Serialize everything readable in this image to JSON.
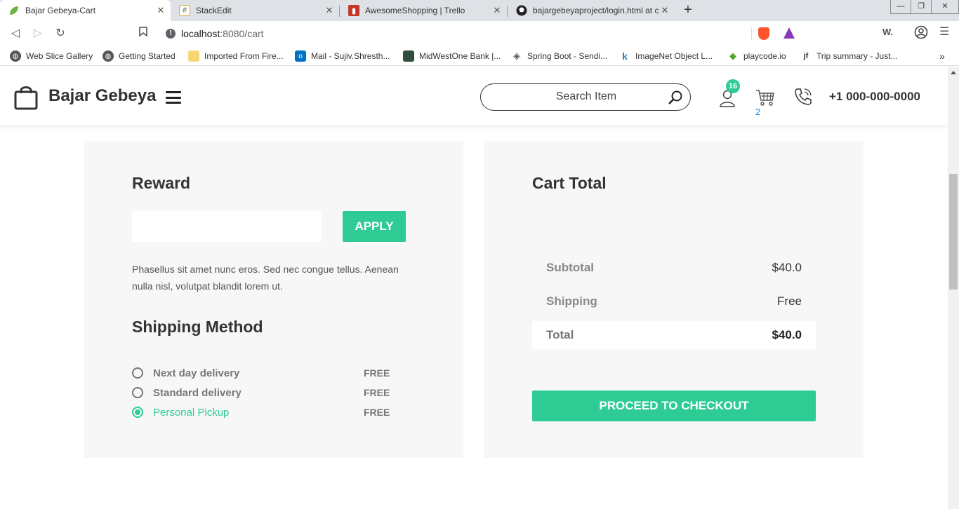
{
  "browser": {
    "tabs": [
      {
        "title": "Bajar Gebeya-Cart",
        "icon": "leaf-icon"
      },
      {
        "title": "StackEdit",
        "icon": "stackedit-icon"
      },
      {
        "title": "AwesomeShopping | Trello",
        "icon": "trello-icon"
      },
      {
        "title": "bajargebeyaproject/login.html at c",
        "icon": "github-icon"
      }
    ],
    "url_host": "localhost",
    "url_path": ":8080/cart",
    "ext_w": "W.",
    "bookmarks": [
      "Web Slice Gallery",
      "Getting Started",
      "Imported From Fire...",
      "Mail - Sujiv.Shresth...",
      "MidWestOne Bank |...",
      "Spring Boot - Sendi...",
      "ImageNet Object L...",
      "playcode.io",
      "Trip summary - Just..."
    ]
  },
  "header": {
    "brand": "Bajar Gebeya",
    "search_placeholder": "Search Item",
    "notification_count": "16",
    "cart_count": "2",
    "phone": "+1 000-000-0000"
  },
  "reward": {
    "title": "Reward",
    "input_value": "",
    "apply_label": "APPLY",
    "description": "Phasellus sit amet nunc eros. Sed nec congue tellus. Aenean nulla nisl, volutpat blandit lorem ut."
  },
  "shipping": {
    "title": "Shipping Method",
    "options": [
      {
        "label": "Next day delivery",
        "price": "FREE",
        "selected": false
      },
      {
        "label": "Standard delivery",
        "price": "FREE",
        "selected": false
      },
      {
        "label": "Personal Pickup",
        "price": "FREE",
        "selected": true
      }
    ]
  },
  "cart_total": {
    "title": "Cart Total",
    "subtotal_label": "Subtotal",
    "subtotal_value": "$40.0",
    "shipping_label": "Shipping",
    "shipping_value": "Free",
    "total_label": "Total",
    "total_value": "$40.0",
    "checkout_label": "PROCEED TO CHECKOUT"
  },
  "colors": {
    "accent": "#2ecc94",
    "panel_bg": "#f7f7f7"
  }
}
